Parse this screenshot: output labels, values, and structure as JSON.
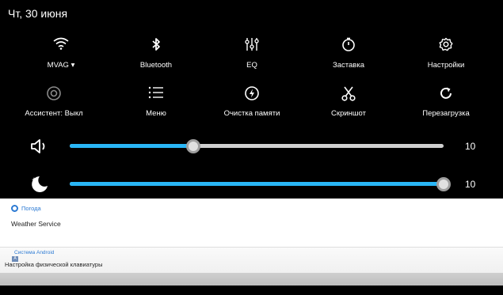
{
  "status": {
    "date": "Чт, 30 июня"
  },
  "tiles_row1": [
    {
      "label": "MVAG ▾",
      "icon": "wifi-icon"
    },
    {
      "label": "Bluetooth",
      "icon": "bluetooth-icon"
    },
    {
      "label": "EQ",
      "icon": "equalizer-icon"
    },
    {
      "label": "Заставка",
      "icon": "screensaver-icon"
    },
    {
      "label": "Настройки",
      "icon": "settings-gear-icon"
    }
  ],
  "tiles_row2": [
    {
      "label": "Ассистент: Выкл",
      "icon": "assistant-icon"
    },
    {
      "label": "Меню",
      "icon": "menu-icon"
    },
    {
      "label": "Очистка памяти",
      "icon": "clean-memory-icon"
    },
    {
      "label": "Скриншот",
      "icon": "scissors-icon"
    },
    {
      "label": "Перезагрузка",
      "icon": "restart-icon"
    }
  ],
  "volume": {
    "icon": "speaker-icon",
    "value": "10",
    "fraction": 0.33
  },
  "brightness": {
    "icon": "moon-icon",
    "value": "10",
    "fraction": 1.0
  },
  "notifications": {
    "weather": {
      "app": "Погода",
      "title": "Weather Service"
    },
    "android": {
      "app": "Система Android",
      "badge": "A",
      "title": "Настройка физической клавиатуры"
    }
  },
  "colors": {
    "accent": "#29b6f6",
    "track": "#cfcfcf",
    "app_name": "#2c7ad3"
  }
}
